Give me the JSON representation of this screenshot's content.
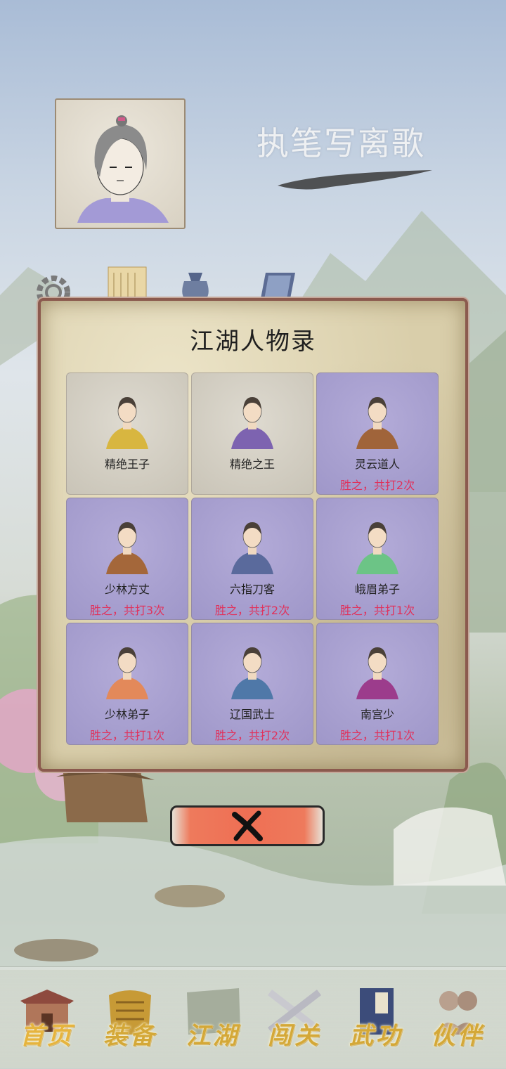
{
  "player": {
    "name": "执笔写离歌"
  },
  "top_icons": [
    "gear-icon",
    "scroll-icon",
    "pouch-icon",
    "book-icon"
  ],
  "modal": {
    "title": "江湖人物录",
    "characters": [
      {
        "name": "精绝王子",
        "status": "",
        "state": "locked",
        "robe": "#d8b640"
      },
      {
        "name": "精绝之王",
        "status": "",
        "state": "locked",
        "robe": "#7d63b0"
      },
      {
        "name": "灵云道人",
        "status": "胜之，共打2次",
        "state": "won",
        "robe": "#a0643a"
      },
      {
        "name": "少林方丈",
        "status": "胜之，共打3次",
        "state": "won",
        "robe": "#a4673a"
      },
      {
        "name": "六指刀客",
        "status": "胜之，共打2次",
        "state": "won",
        "robe": "#5a6a9c"
      },
      {
        "name": "峨眉弟子",
        "status": "胜之，共打1次",
        "state": "won",
        "robe": "#6cc486"
      },
      {
        "name": "少林弟子",
        "status": "胜之，共打1次",
        "state": "won",
        "robe": "#e3895a"
      },
      {
        "name": "辽国武士",
        "status": "胜之，共打2次",
        "state": "won",
        "robe": "#4f78a8"
      },
      {
        "name": "南宫少",
        "status": "胜之，共打1次",
        "state": "won",
        "robe": "#9c3c8c"
      }
    ],
    "close_icon": "close-icon"
  },
  "nav": [
    {
      "label": "首页",
      "icon": "house-icon",
      "active": true
    },
    {
      "label": "装备",
      "icon": "armor-icon"
    },
    {
      "label": "江湖",
      "icon": "map-icon"
    },
    {
      "label": "闯关",
      "icon": "swords-icon"
    },
    {
      "label": "武功",
      "icon": "manual-icon"
    },
    {
      "label": "伙伴",
      "icon": "companions-icon"
    }
  ],
  "colors": {
    "accent_gold": "#d4a838",
    "win_text": "#e0325c",
    "modal_border": "#8b5a4e",
    "close_button": "#ef6f54"
  }
}
